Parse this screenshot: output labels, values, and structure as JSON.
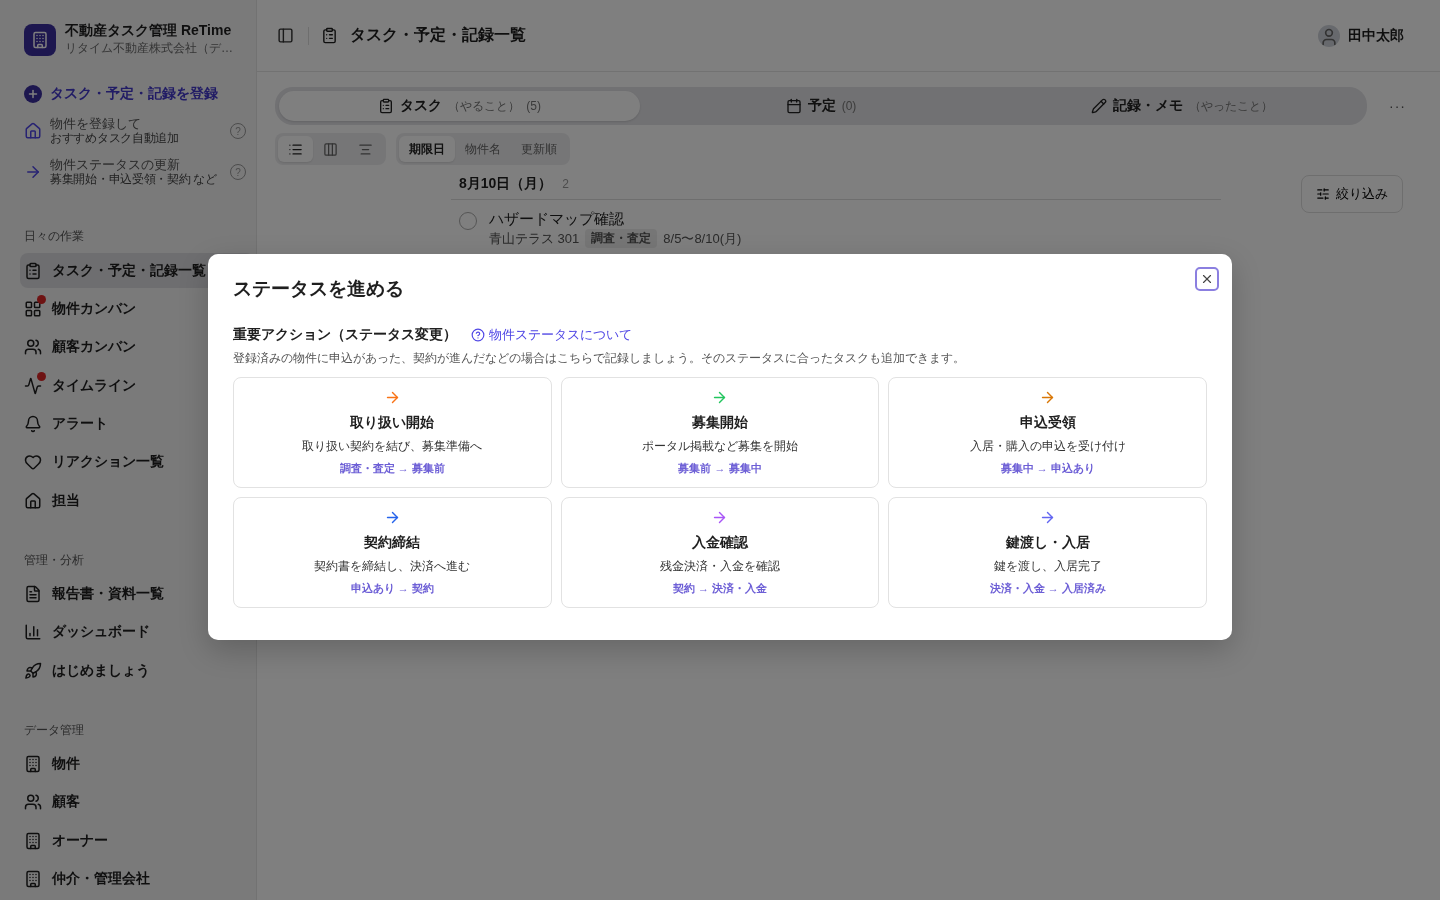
{
  "app": {
    "name": "不動産タスク管理 ReTime",
    "company": "リタイム不動産株式会社（デ…"
  },
  "sidebar": {
    "register_button": "タスク・予定・記録を登録",
    "shortcuts": [
      {
        "kind": "home",
        "title": "物件を登録して",
        "subtitle": "おすすめタスク自動追加",
        "help": "?"
      },
      {
        "kind": "arrow",
        "title": "物件ステータスの更新",
        "subtitle": "募集開始・申込受領・契約 など",
        "help": "?"
      }
    ],
    "sections": [
      {
        "title": "日々の作業",
        "items": [
          {
            "label": "タスク・予定・記録一覧",
            "selected": true,
            "dot": false
          },
          {
            "label": "物件カンバン",
            "selected": false,
            "dot": true
          },
          {
            "label": "顧客カンバン",
            "selected": false,
            "dot": false
          },
          {
            "label": "タイムライン",
            "selected": false,
            "dot": true
          },
          {
            "label": "アラート",
            "selected": false,
            "dot": false
          },
          {
            "label": "リアクション一覧",
            "selected": false,
            "dot": false
          },
          {
            "label": "担当",
            "selected": false,
            "dot": false
          }
        ]
      },
      {
        "title": "管理・分析",
        "items": [
          {
            "label": "報告書・資料一覧",
            "selected": false,
            "dot": false
          },
          {
            "label": "ダッシュボード",
            "selected": false,
            "dot": false
          },
          {
            "label": "はじめましょう",
            "selected": false,
            "dot": false
          }
        ]
      },
      {
        "title": "データ管理",
        "items": [
          {
            "label": "物件",
            "selected": false,
            "dot": false
          },
          {
            "label": "顧客",
            "selected": false,
            "dot": false
          },
          {
            "label": "オーナー",
            "selected": false,
            "dot": false
          },
          {
            "label": "仲介・管理会社",
            "selected": false,
            "dot": false
          }
        ]
      }
    ]
  },
  "header": {
    "title": "タスク・予定・記録一覧",
    "user": "田中太郎"
  },
  "tabs": [
    {
      "label": "タスク",
      "note": "（やること）",
      "count": "(5)",
      "selected": true
    },
    {
      "label": "予定",
      "count": "(0)",
      "selected": false
    },
    {
      "label": "記録・メモ",
      "note": "（やったこと）",
      "selected": false
    }
  ],
  "more_button": "···",
  "view_modes": [
    {
      "kind": "list",
      "selected": true
    },
    {
      "kind": "board",
      "selected": false
    },
    {
      "kind": "outline",
      "selected": false
    }
  ],
  "sort_options": [
    {
      "label": "期限日",
      "selected": true
    },
    {
      "label": "物件名",
      "selected": false
    },
    {
      "label": "更新順",
      "selected": false
    }
  ],
  "filter_button": "絞り込み",
  "date_group": {
    "date": "8月10日（月）",
    "count": "2"
  },
  "tasks": [
    {
      "title": "ハザードマップ確認",
      "property": "青山テラス 301",
      "tag": "調査・査定",
      "period": "8/5〜8/10(月)",
      "checked": false
    }
  ],
  "dialog": {
    "title": "ステータスを進める",
    "section_title": "重要アクション（ステータス変更）",
    "help_link": "物件ステータスについて",
    "description": "登録済みの物件に申込があった、契約が進んだなどの場合はこちらで記録しましょう。そのステータスに合ったタスクも追加できます。",
    "actions": [
      {
        "title": "取り扱い開始",
        "description": "取り扱い契約を結び、募集準備へ",
        "transition": "調査・査定 → 募集前",
        "color": "#f97316"
      },
      {
        "title": "募集開始",
        "description": "ポータル掲載など募集を開始",
        "transition": "募集前 → 募集中",
        "color": "#22c55e"
      },
      {
        "title": "申込受領",
        "description": "入居・購入の申込を受け付け",
        "transition": "募集中 → 申込あり",
        "color": "#d97706"
      },
      {
        "title": "契約締結",
        "description": "契約書を締結し、決済へ進む",
        "transition": "申込あり → 契約",
        "color": "#2563eb"
      },
      {
        "title": "入金確認",
        "description": "残金決済・入金を確認",
        "transition": "契約 → 決済・入金",
        "color": "#a855f7"
      },
      {
        "title": "鍵渡し・入居",
        "description": "鍵を渡し、入居完了",
        "transition": "決済・入金 → 入居済み",
        "color": "#6366f1"
      }
    ]
  }
}
